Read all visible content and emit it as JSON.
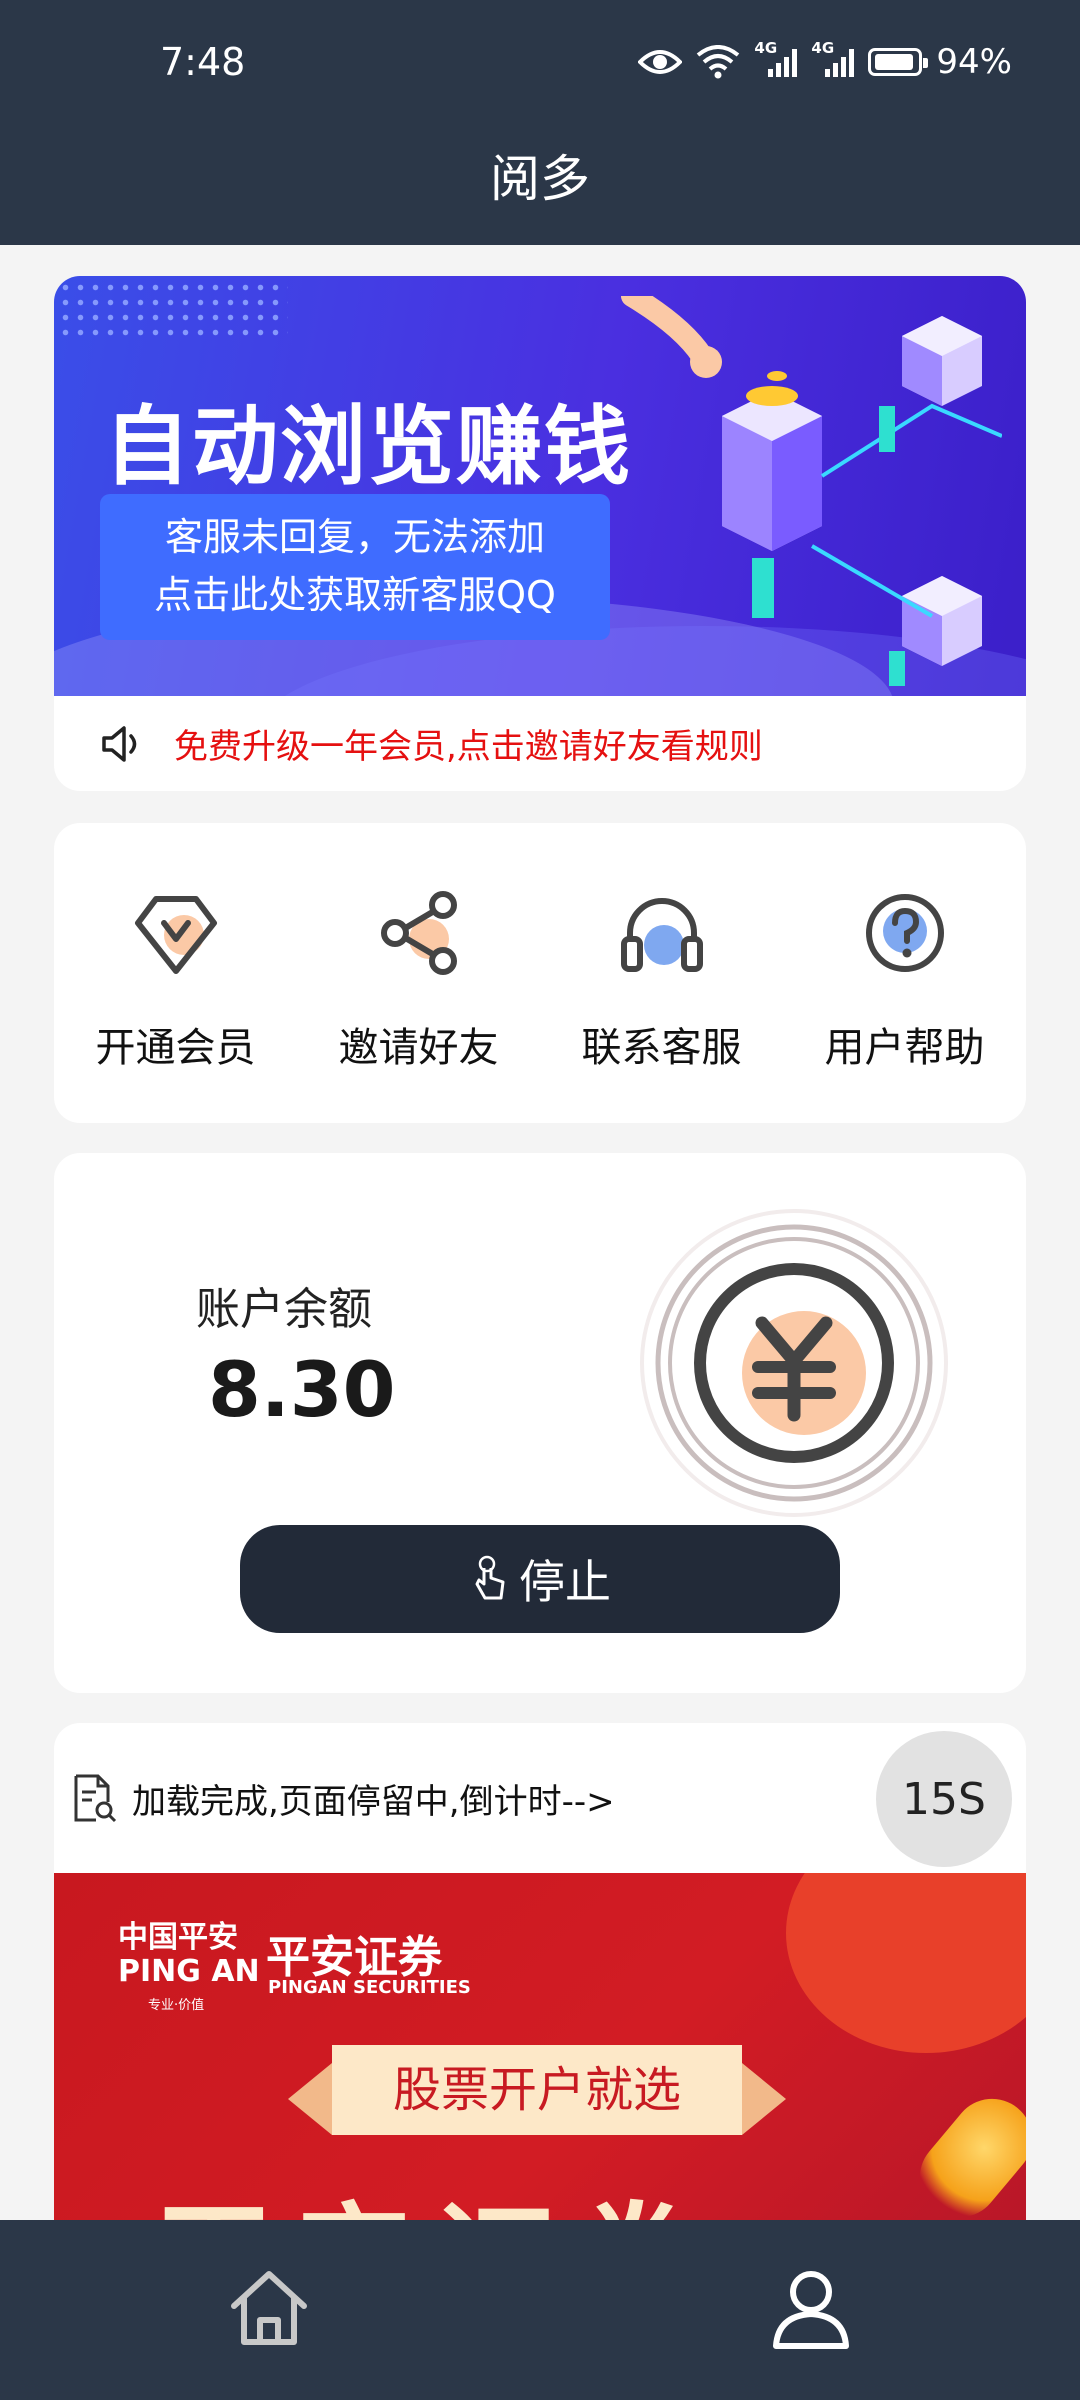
{
  "status_bar": {
    "time": "7:48",
    "network_labels": [
      "4G",
      "4G"
    ],
    "battery": "94%"
  },
  "header": {
    "title": "阅多"
  },
  "banner": {
    "headline": "自动浏览赚钱",
    "sub_line1": "客服未回复，无法添加",
    "sub_line2": "点击此处获取新客服QQ"
  },
  "notice": {
    "text": "免费升级一年会员,点击邀请好友看规则"
  },
  "features": [
    {
      "label": "开通会员",
      "icon": "vip-icon"
    },
    {
      "label": "邀请好友",
      "icon": "share-icon"
    },
    {
      "label": "联系客服",
      "icon": "headset-icon"
    },
    {
      "label": "用户帮助",
      "icon": "help-icon"
    }
  ],
  "balance": {
    "label": "账户余额",
    "amount": "8.30",
    "button_label": "停止",
    "coin_icon": "yuan-icon"
  },
  "loading": {
    "status_text": "加载完成,页面停留中,倒计时-->",
    "countdown": "15S"
  },
  "ad": {
    "brand_cn": "中国平安",
    "brand_en": "PING AN",
    "brand_slogan": "专业·价值",
    "product_cn": "平安证券",
    "product_en": "PINGAN SECURITIES",
    "ribbon": "股票开户就选",
    "headline": "平安证券"
  },
  "bottom_nav": [
    {
      "name": "home",
      "icon": "home-icon"
    },
    {
      "name": "profile",
      "icon": "user-icon"
    }
  ],
  "colors": {
    "dark_bar": "#2b3748",
    "notice_red": "#e51010",
    "button_dark": "#222a38",
    "accent_peach": "#fbc9a6",
    "accent_blue": "#7fa8f0"
  }
}
